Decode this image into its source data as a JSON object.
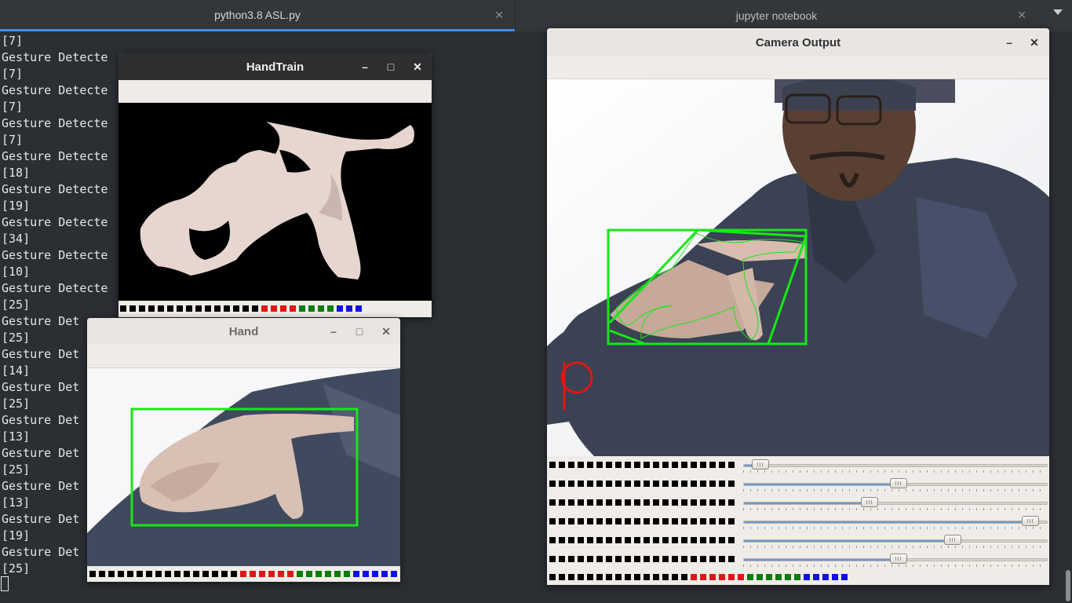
{
  "tabs": [
    {
      "label": "python3.8 ASL.py",
      "active": true
    },
    {
      "label": "jupyter notebook",
      "active": false
    }
  ],
  "close_glyph": "✕",
  "terminal": {
    "lines": [
      "[7]",
      "Gesture Detecte",
      "[7]",
      "Gesture Detecte",
      "[7]",
      "Gesture Detecte",
      "[7]",
      "Gesture Detecte",
      "[18]",
      "Gesture Detecte",
      "[19]",
      "Gesture Detecte",
      "[34]",
      "Gesture Detecte",
      "[10]",
      "Gesture Detecte",
      "[25]",
      "Gesture Det",
      "[25]",
      "Gesture Det",
      "[14]",
      "Gesture Det",
      "[25]",
      "Gesture Det",
      "[13]",
      "Gesture Det",
      "[25]",
      "Gesture Det",
      "[13]",
      "Gesture Det",
      "[19]",
      "Gesture Det",
      "[25]"
    ]
  },
  "windows": {
    "handtrain": {
      "title": "HandTrain"
    },
    "hand": {
      "title": "Hand"
    },
    "camera": {
      "title": "Camera Output",
      "overlay_letter": "p"
    }
  },
  "window_controls": {
    "minimize": "–",
    "maximize": "□",
    "close": "✕"
  },
  "sliders": [
    {
      "value": 0.03
    },
    {
      "value": 0.51
    },
    {
      "value": 0.41
    },
    {
      "value": 0.97
    },
    {
      "value": 0.7
    },
    {
      "value": 0.51
    }
  ],
  "colors": {
    "terminal_bg": "#2b2e33",
    "accent_tab": "#3d8fe8",
    "detection_box": "#17e817",
    "overlay_letter": "#e01616",
    "status_red": "#e01616",
    "status_green": "#0b7d0b",
    "status_blue": "#1010e6"
  }
}
